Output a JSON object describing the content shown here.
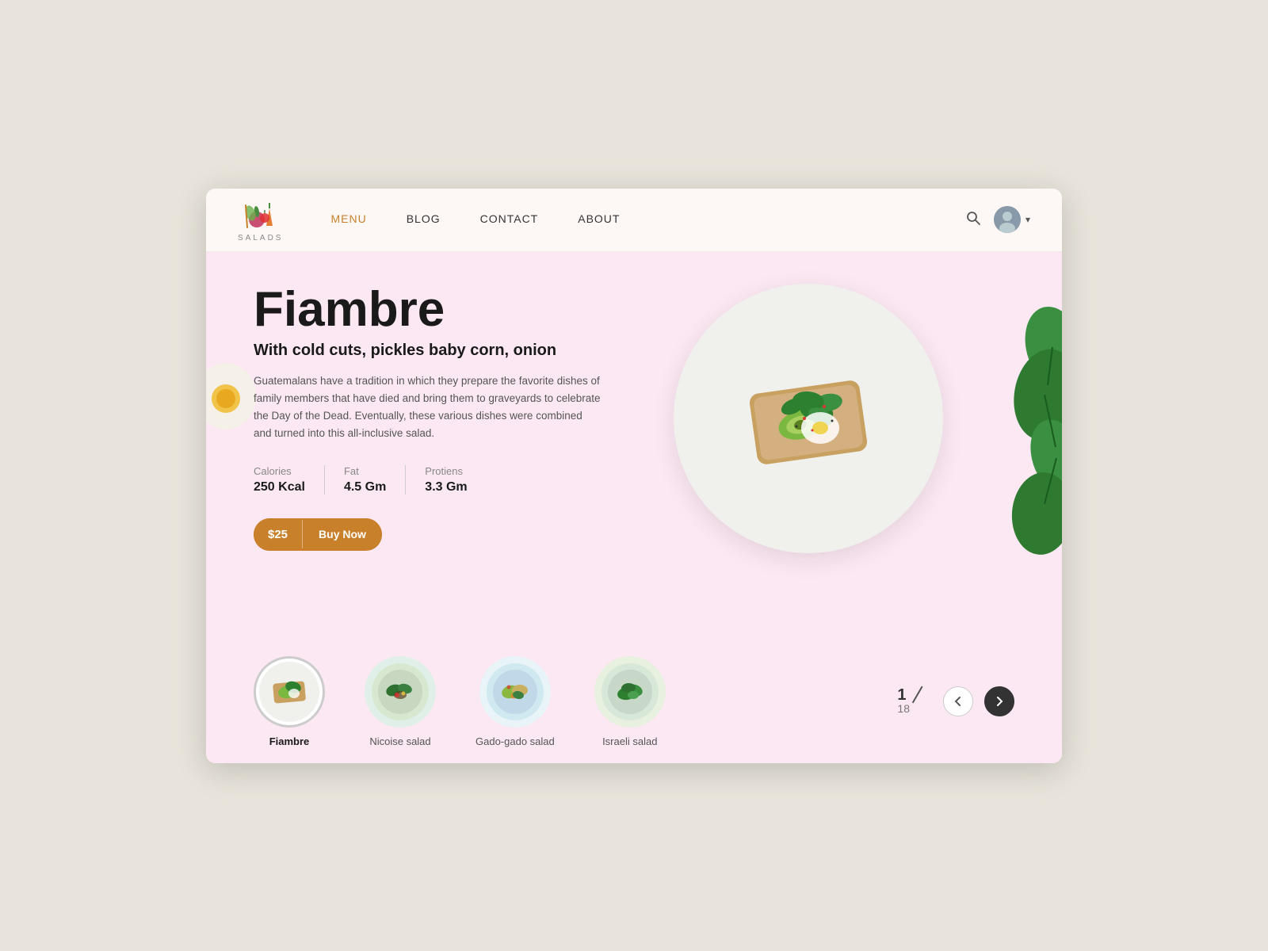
{
  "nav": {
    "logo_text": "SALADS",
    "links": [
      {
        "label": "MENU",
        "active": true
      },
      {
        "label": "BLOG",
        "active": false
      },
      {
        "label": "CONTACT",
        "active": false
      },
      {
        "label": "ABOUT",
        "active": false
      }
    ]
  },
  "hero": {
    "title": "Fiambre",
    "subtitle": "With cold cuts, pickles baby corn, onion",
    "description": "Guatemalans have a tradition in which they prepare the favorite dishes of family members that have died and bring them to graveyards to celebrate the Day of the Dead. Eventually, these various dishes were combined and turned into this all-inclusive salad.",
    "nutrition": [
      {
        "label": "Calories",
        "value": "250 Kcal"
      },
      {
        "label": "Fat",
        "value": "4.5 Gm"
      },
      {
        "label": "Protiens",
        "value": "3.3 Gm"
      }
    ],
    "price": "$25",
    "buy_label": "Buy Now"
  },
  "thumbnails": [
    {
      "label": "Fiambre",
      "active": true
    },
    {
      "label": "Nicoise salad",
      "active": false
    },
    {
      "label": "Gado-gado salad",
      "active": false
    },
    {
      "label": "Israeli salad",
      "active": false
    }
  ],
  "pagination": {
    "current": "1",
    "total": "18"
  }
}
